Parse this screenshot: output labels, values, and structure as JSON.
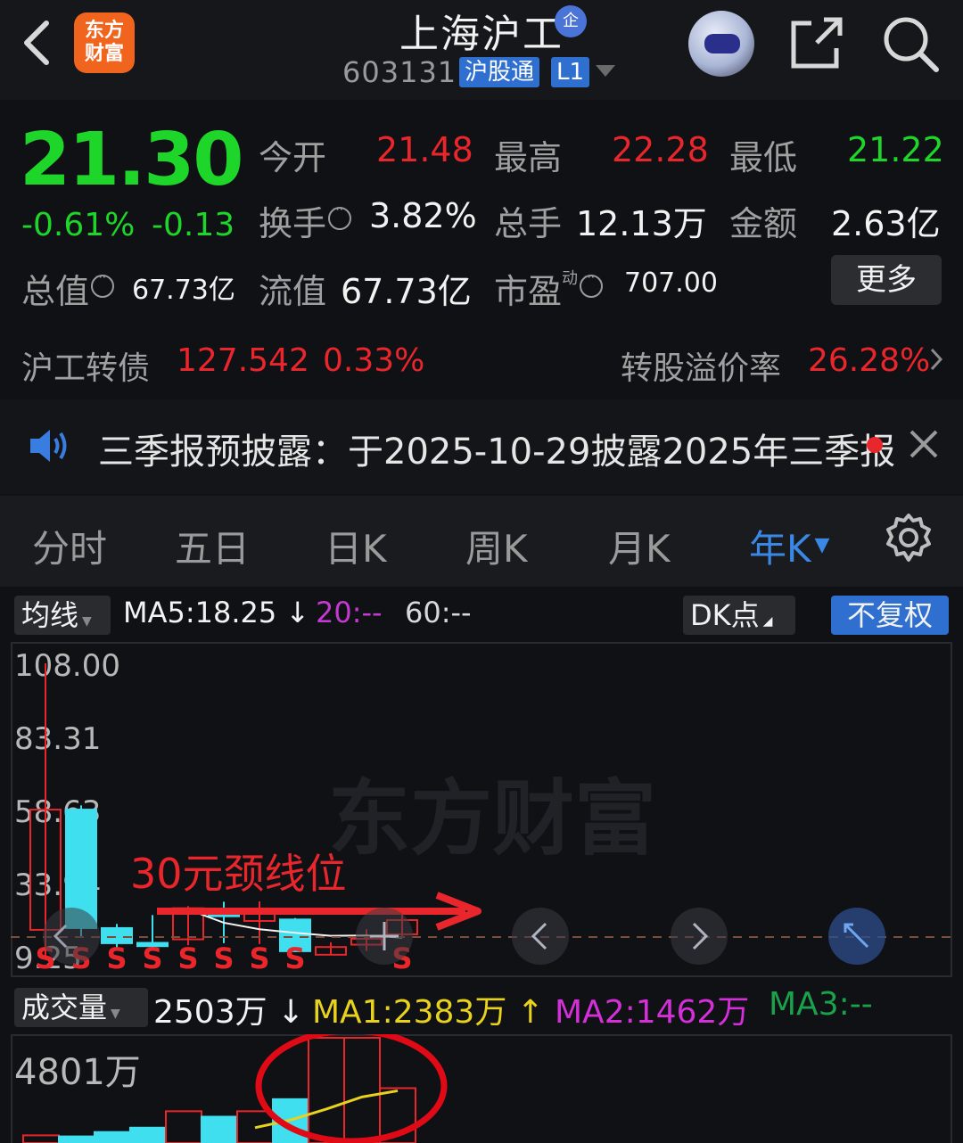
{
  "header": {
    "logo_line1": "东方",
    "logo_line2": "财富",
    "stock_name": "上海沪工",
    "corp_badge": "企",
    "stock_code": "603131",
    "connect_badge": "沪股通",
    "level_badge": "L1"
  },
  "quote": {
    "price": "21.30",
    "change_pct": "-0.61%",
    "change_abs": "-0.13",
    "open_label": "今开",
    "open_value": "21.48",
    "high_label": "最高",
    "high_value": "22.28",
    "low_label": "最低",
    "low_value": "21.22",
    "turnover_label": "换手",
    "turnover_value": "3.82%",
    "volume_label": "总手",
    "volume_value": "12.13万",
    "amount_label": "金额",
    "amount_value": "2.63亿",
    "total_cap_label": "总值",
    "total_cap_value": "67.73亿",
    "float_cap_label": "流值",
    "float_cap_value": "67.73亿",
    "pe_label": "市盈",
    "pe_sup": "动",
    "pe_value": "707.00",
    "more_button": "更多"
  },
  "bond": {
    "label": "沪工转债",
    "price": "127.542",
    "change": "0.33%",
    "premium_label": "转股溢价率",
    "premium_value": "26.28%"
  },
  "notice": {
    "text": "三季报预披露：于2025-10-29披露2025年三季报"
  },
  "tabs": [
    "分时",
    "五日",
    "日K",
    "周K",
    "月K",
    "年K"
  ],
  "indicator_row": {
    "ma_select": "均线",
    "ma5": "MA5:18.25",
    "ma20": "20:--",
    "ma60": "60:--",
    "dk_button": "DK点",
    "fq_button": "不复权"
  },
  "kchart": {
    "y_labels": [
      "108.00",
      "83.31",
      "58.63",
      "33.94",
      "9.25"
    ],
    "watermark": "东方财富",
    "annotation": "30元颈线位"
  },
  "volume_row": {
    "select": "成交量",
    "volume": "2503万",
    "ma1": "MA1:2383万",
    "ma2": "MA2:1462万",
    "ma3": "MA3:--",
    "y_label": "4801万"
  },
  "colors": {
    "up": "#e8262b",
    "down": "#1ed62a",
    "accent": "#3a88e6",
    "cyan_candle": "#3fdff0"
  },
  "chart_data": {
    "type": "candlestick",
    "ylim": [
      9.25,
      108.0
    ],
    "y_ticks": [
      108.0,
      83.31,
      58.63,
      33.94,
      9.25
    ],
    "candles": [
      {
        "open": 18.0,
        "close": 58.6,
        "high": 108.0,
        "low": 9.25,
        "up": true,
        "signal": "S"
      },
      {
        "open": 58.6,
        "close": 18.6,
        "high": 60.0,
        "low": 15.5,
        "up": false,
        "signal": "S"
      },
      {
        "open": 18.6,
        "close": 13.5,
        "high": 20.0,
        "low": 11.0,
        "up": false,
        "signal": "S"
      },
      {
        "open": 13.6,
        "close": 12.5,
        "high": 23.0,
        "low": 11.0,
        "up": false,
        "signal": "S"
      },
      {
        "open": 14.8,
        "close": 25.3,
        "high": 26.0,
        "low": 12.8,
        "up": true,
        "signal": "S"
      },
      {
        "open": 24.5,
        "close": 22.6,
        "high": 27.5,
        "low": 13.5,
        "up": false,
        "signal": "S"
      },
      {
        "open": 21.0,
        "close": 24.6,
        "high": 27.6,
        "low": 13.2,
        "up": true,
        "signal": "S"
      },
      {
        "open": 21.5,
        "close": 10.8,
        "high": 22.0,
        "low": 10.5,
        "up": false,
        "signal": "S"
      },
      {
        "open": 9.6,
        "close": 12.2,
        "high": 13.8,
        "low": 9.4,
        "up": true,
        "signal": ""
      },
      {
        "open": 13.0,
        "close": 15.0,
        "high": 18.2,
        "low": 10.9,
        "up": true,
        "signal": ""
      },
      {
        "open": 16.5,
        "close": 21.3,
        "high": 24.0,
        "low": 15.5,
        "up": true,
        "signal": "S"
      }
    ],
    "ma5": [
      null,
      null,
      null,
      null,
      24.9,
      20.4,
      18.2,
      17.0,
      16.0,
      16.1,
      15.4
    ],
    "volume": {
      "ylim": [
        0,
        4801
      ],
      "values": [
        350,
        300,
        500,
        700,
        1450,
        1200,
        1450,
        2000,
        4801,
        4801,
        2503
      ],
      "up": [
        true,
        false,
        false,
        false,
        true,
        false,
        true,
        false,
        true,
        true,
        true
      ],
      "ma1": [
        null,
        null,
        null,
        null,
        null,
        null,
        700,
        1050,
        1550,
        2100,
        2383
      ]
    }
  }
}
